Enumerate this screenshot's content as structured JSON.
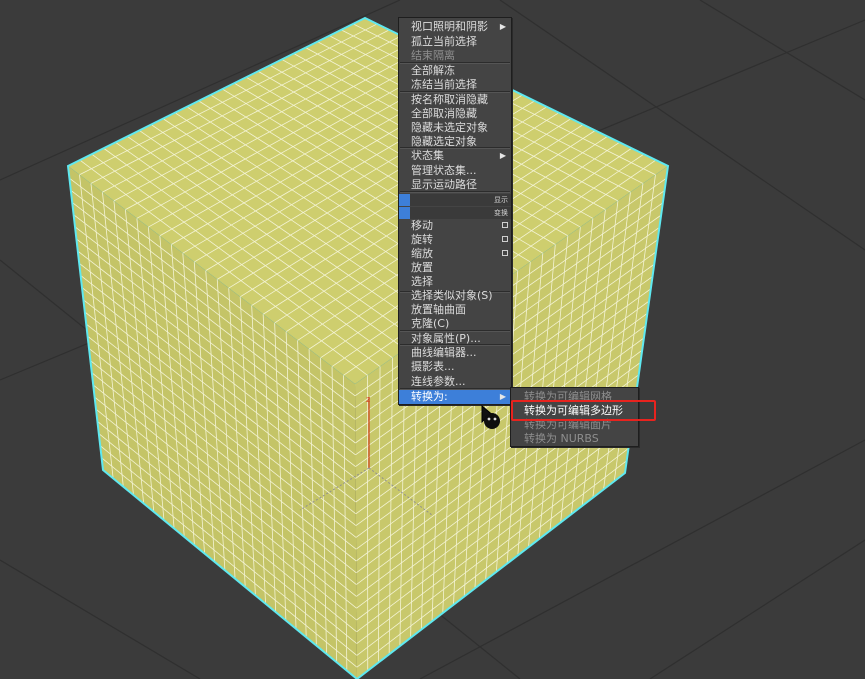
{
  "context_menu": {
    "items": [
      {
        "label": "视口照明和阴影",
        "submenu": true
      },
      {
        "label": "孤立当前选择"
      },
      {
        "label": "结束隔离",
        "disabled": true
      },
      {
        "label": "全部解冻"
      },
      {
        "label": "冻结当前选择"
      },
      {
        "label": "按名称取消隐藏"
      },
      {
        "label": "全部取消隐藏"
      },
      {
        "label": "隐藏未选定对象"
      },
      {
        "label": "隐藏选定对象"
      },
      {
        "label": "状态集",
        "submenu": true
      },
      {
        "label": "管理状态集..."
      },
      {
        "label": "显示运动路径"
      },
      {
        "label": "移动"
      },
      {
        "label": "旋转"
      },
      {
        "label": "缩放"
      },
      {
        "label": "放置"
      },
      {
        "label": "选择"
      },
      {
        "label": "选择类似对象(S)"
      },
      {
        "label": "放置轴曲面"
      },
      {
        "label": "克隆(C)"
      },
      {
        "label": "对象属性(P)..."
      },
      {
        "label": "曲线编辑器..."
      },
      {
        "label": "摄影表..."
      },
      {
        "label": "连线参数..."
      },
      {
        "label": "转换为:",
        "submenu": true,
        "highlighted": true
      }
    ],
    "quad_labels": {
      "display": "显示",
      "transform": "变换"
    }
  },
  "convert_submenu": {
    "items": [
      {
        "label": "转换为可编辑网格"
      },
      {
        "label": "转换为可编辑多边形",
        "selected": true
      },
      {
        "label": "转换为可编辑面片"
      },
      {
        "label": "转换为 NURBS"
      }
    ]
  },
  "colors": {
    "background": "#3b3b3b",
    "box_face": "#c9c96a",
    "selection_outline": "#5ee8f0",
    "menu_highlight": "#3d7fd9",
    "annotation": "#e8231e"
  }
}
